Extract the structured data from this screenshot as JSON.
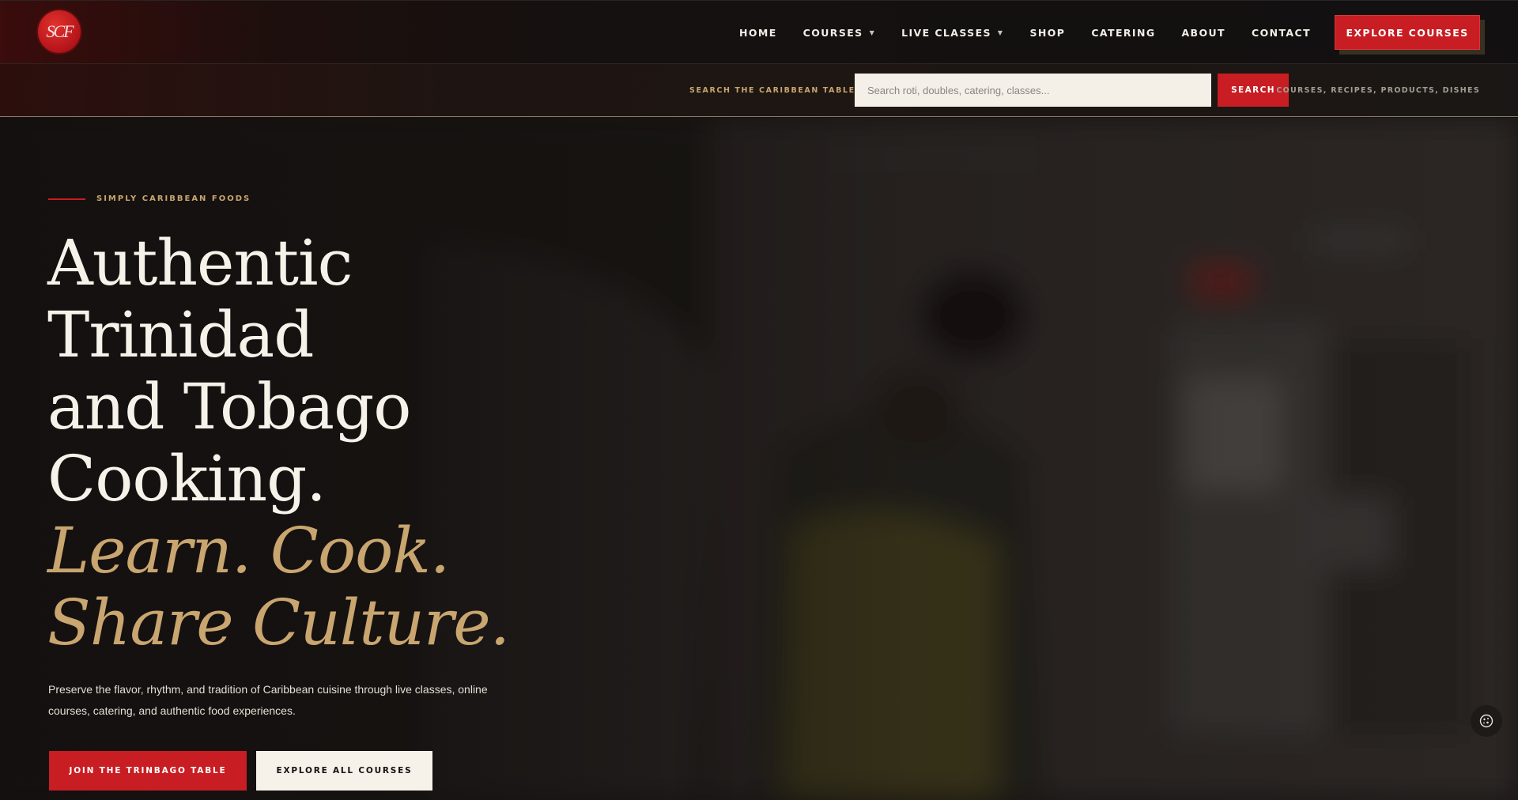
{
  "brand": {
    "logo_text": "SCF",
    "accent_color": "#c81d22",
    "gold_color": "#c9a56f"
  },
  "nav": {
    "items": [
      {
        "label": "HOME",
        "has_dropdown": false
      },
      {
        "label": "COURSES",
        "has_dropdown": true
      },
      {
        "label": "LIVE CLASSES",
        "has_dropdown": true
      },
      {
        "label": "SHOP",
        "has_dropdown": false
      },
      {
        "label": "CATERING",
        "has_dropdown": false
      },
      {
        "label": "ABOUT",
        "has_dropdown": false
      },
      {
        "label": "CONTACT",
        "has_dropdown": false
      }
    ],
    "dropdown_caret": "▼",
    "cta_label": "EXPLORE COURSES"
  },
  "search": {
    "label": "SEARCH THE CARIBBEAN TABLE",
    "placeholder": "Search roti, doubles, catering, classes...",
    "value": "",
    "button_label": "SEARCH",
    "hint": "COURSES, RECIPES, PRODUCTS, DISHES"
  },
  "hero": {
    "eyebrow": "SIMPLY CARIBBEAN FOODS",
    "headline_lines": [
      "Authentic",
      "Trinidad",
      "and Tobago",
      "Cooking."
    ],
    "accent_lines": [
      "Learn. Cook.",
      "Share Culture."
    ],
    "copy": "Preserve the flavor, rhythm, and tradition of Caribbean cuisine through live classes, online courses, catering, and authentic food experiences.",
    "primary_button": "JOIN THE TRINBAGO TABLE",
    "secondary_button": "EXPLORE ALL COURSES"
  },
  "icons": {
    "cookie": "cookie-icon"
  }
}
